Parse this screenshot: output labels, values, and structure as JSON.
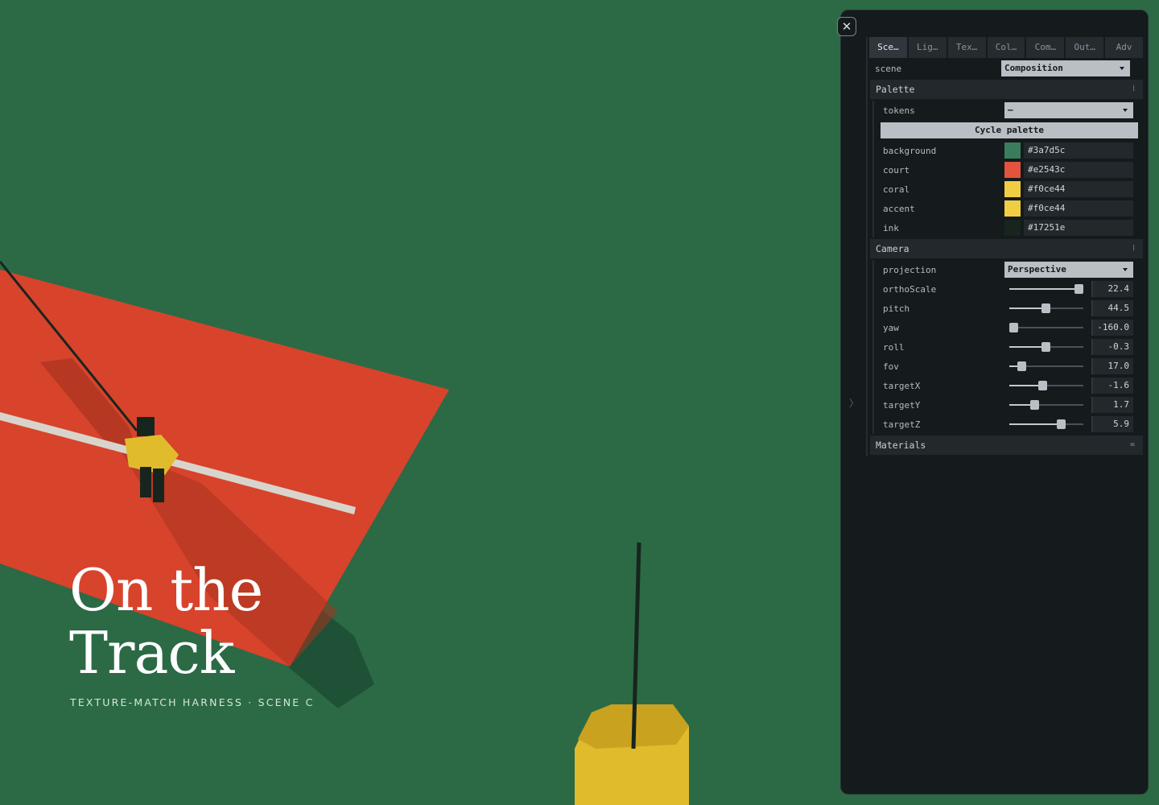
{
  "hero": {
    "title_line1": "On the",
    "title_line2": "Track",
    "subtitle": "TEXTURE-MATCH HARNESS · SCENE C"
  },
  "panel": {
    "close_icon": "close-icon",
    "tabs": [
      {
        "label": "Sce…",
        "active": true
      },
      {
        "label": "Lig…"
      },
      {
        "label": "Tex…"
      },
      {
        "label": "Col…"
      },
      {
        "label": "Com…"
      },
      {
        "label": "Out…"
      },
      {
        "label": "Adv"
      }
    ],
    "scene": {
      "label": "scene",
      "value": "Composition"
    },
    "palette": {
      "title": "Palette",
      "tokens": {
        "label": "tokens",
        "value": "—"
      },
      "cycle_button": "Cycle palette",
      "colors": [
        {
          "label": "background",
          "value": "#3a7d5c",
          "swatch": "#3a7d5c"
        },
        {
          "label": "court",
          "value": "#e2543c",
          "swatch": "#e2543c"
        },
        {
          "label": "coral",
          "value": "#f0ce44",
          "swatch": "#f0ce44"
        },
        {
          "label": "accent",
          "value": "#f0ce44",
          "swatch": "#f0ce44"
        },
        {
          "label": "ink",
          "value": "#17251e",
          "swatch": "#17251e"
        }
      ]
    },
    "camera": {
      "title": "Camera",
      "projection": {
        "label": "projection",
        "value": "Perspective"
      },
      "sliders": [
        {
          "label": "orthoScale",
          "value": "22.4",
          "fraction": 0.93
        },
        {
          "label": "pitch",
          "value": "44.5",
          "fraction": 0.49
        },
        {
          "label": "yaw",
          "value": "-160.0",
          "fraction": 0.05
        },
        {
          "label": "roll",
          "value": "-0.3",
          "fraction": 0.49
        },
        {
          "label": "fov",
          "value": "17.0",
          "fraction": 0.16
        },
        {
          "label": "targetX",
          "value": "-1.6",
          "fraction": 0.45
        },
        {
          "label": "targetY",
          "value": "1.7",
          "fraction": 0.34
        },
        {
          "label": "targetZ",
          "value": "5.9",
          "fraction": 0.7
        }
      ]
    },
    "materials": {
      "title": "Materials"
    }
  },
  "colors": {
    "field": "#2b6a45",
    "court": "#d8432c",
    "yellow": "#e0bb2c",
    "ink": "#17251e",
    "line": "#d8d4cc"
  }
}
